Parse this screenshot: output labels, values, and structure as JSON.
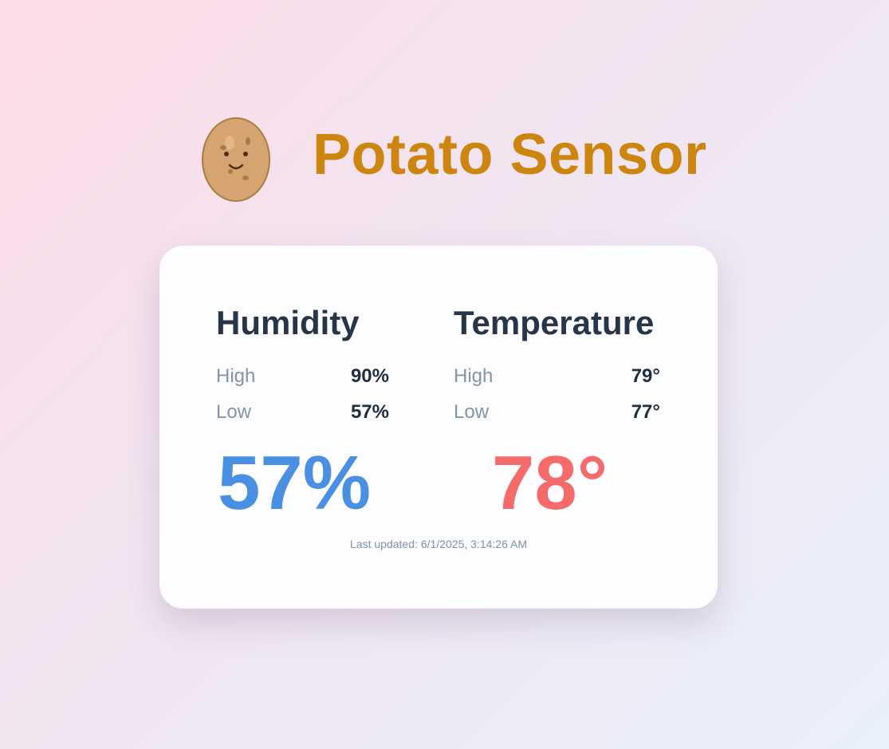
{
  "app": {
    "title": "Potato Sensor",
    "icon": "potato-icon"
  },
  "humidity": {
    "title": "Humidity",
    "high_label": "High",
    "high_value": "90%",
    "low_label": "Low",
    "low_value": "57%",
    "current": "57%",
    "color": "#4a90e2"
  },
  "temperature": {
    "title": "Temperature",
    "high_label": "High",
    "high_value": "79°",
    "low_label": "Low",
    "low_value": "77°",
    "current": "78°",
    "color": "#f56b6c"
  },
  "status": {
    "last_updated_label": "Last updated:",
    "last_updated_value": "6/1/2025, 3:14:26 AM"
  },
  "colors": {
    "title": "#cc8610",
    "heading": "#273548",
    "muted": "#8294ae"
  }
}
